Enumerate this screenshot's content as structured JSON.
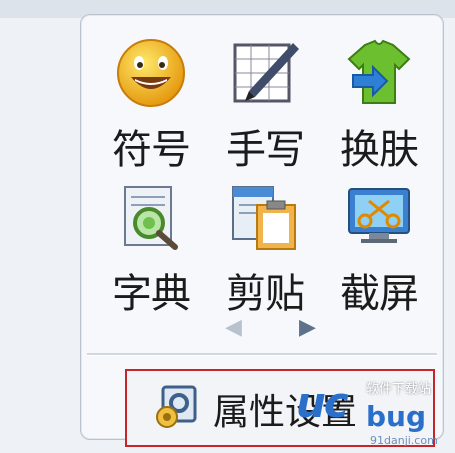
{
  "tools": [
    {
      "label": "符号",
      "icon": "smiley-icon"
    },
    {
      "label": "手写",
      "icon": "pen-pad-icon"
    },
    {
      "label": "换肤",
      "icon": "shirt-skin-icon"
    },
    {
      "label": "字典",
      "icon": "dictionary-search-icon"
    },
    {
      "label": "剪贴",
      "icon": "clipboard-icon"
    },
    {
      "label": "截屏",
      "icon": "screenshot-icon"
    }
  ],
  "settings": {
    "label": "属性设置",
    "icon": "settings-gear-icon"
  },
  "watermark": {
    "brand": "uc",
    "tag": "软件下载站",
    "tail": "bug",
    "url": "91danji.com"
  },
  "colors": {
    "accent_red": "#c4262c",
    "panel_bg": "#f6f8fb",
    "brand_blue": "#2a6fc9"
  }
}
